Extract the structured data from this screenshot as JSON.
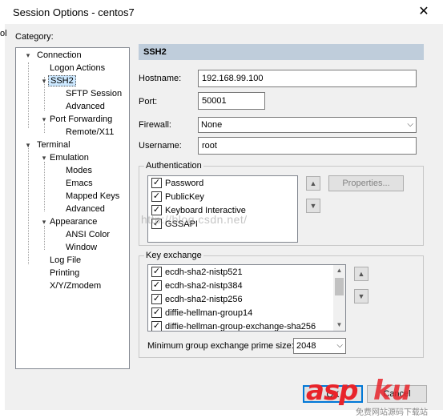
{
  "window": {
    "title": "Session Options - centos7",
    "edge_text": "ol"
  },
  "category": {
    "label": "Category:"
  },
  "tree": [
    {
      "label": "Connection",
      "expander": "minus"
    },
    {
      "label": "Logon Actions"
    },
    {
      "label": "SSH2",
      "selected": true,
      "expander": "minus"
    },
    {
      "label": "SFTP Session"
    },
    {
      "label": "Advanced"
    },
    {
      "label": "Port Forwarding",
      "expander": "minus"
    },
    {
      "label": "Remote/X11"
    },
    {
      "label": "Terminal",
      "expander": "minus"
    },
    {
      "label": "Emulation",
      "expander": "minus"
    },
    {
      "label": "Modes"
    },
    {
      "label": "Emacs"
    },
    {
      "label": "Mapped Keys"
    },
    {
      "label": "Advanced"
    },
    {
      "label": "Appearance",
      "expander": "minus"
    },
    {
      "label": "ANSI Color"
    },
    {
      "label": "Window"
    },
    {
      "label": "Log File"
    },
    {
      "label": "Printing"
    },
    {
      "label": "X/Y/Zmodem"
    }
  ],
  "ssh2": {
    "header": "SSH2",
    "hostname_label": "Hostname:",
    "hostname_value": "192.168.99.100",
    "port_label": "Port:",
    "port_value": "50001",
    "firewall_label": "Firewall:",
    "firewall_value": "None",
    "username_label": "Username:",
    "username_value": "root"
  },
  "authentication": {
    "title": "Authentication",
    "items": [
      {
        "label": "Password",
        "checked": true
      },
      {
        "label": "PublicKey",
        "checked": true
      },
      {
        "label": "Keyboard Interactive",
        "checked": true
      },
      {
        "label": "GSSAPI",
        "checked": true
      }
    ],
    "properties_button": "Properties..."
  },
  "key_exchange": {
    "title": "Key exchange",
    "items": [
      {
        "label": "ecdh-sha2-nistp521",
        "checked": true
      },
      {
        "label": "ecdh-sha2-nistp384",
        "checked": true
      },
      {
        "label": "ecdh-sha2-nistp256",
        "checked": true
      },
      {
        "label": "diffie-hellman-group14",
        "checked": true
      },
      {
        "label": "diffie-hellman-group-exchange-sha256",
        "checked": true
      }
    ],
    "min_prime_label": "Minimum group exchange prime size:",
    "min_prime_value": "2048"
  },
  "watermark": "http://blog.csdn.net/",
  "buttons": {
    "ok": "OK",
    "cancel": "Cancel"
  },
  "logo": {
    "asp": "asp",
    "ku": "ku",
    "cn": "免费网站源码下载站"
  },
  "colors": {
    "section_header": "#bfcddb",
    "selection": "#cce8ff",
    "logo_red": "#e8232a"
  }
}
